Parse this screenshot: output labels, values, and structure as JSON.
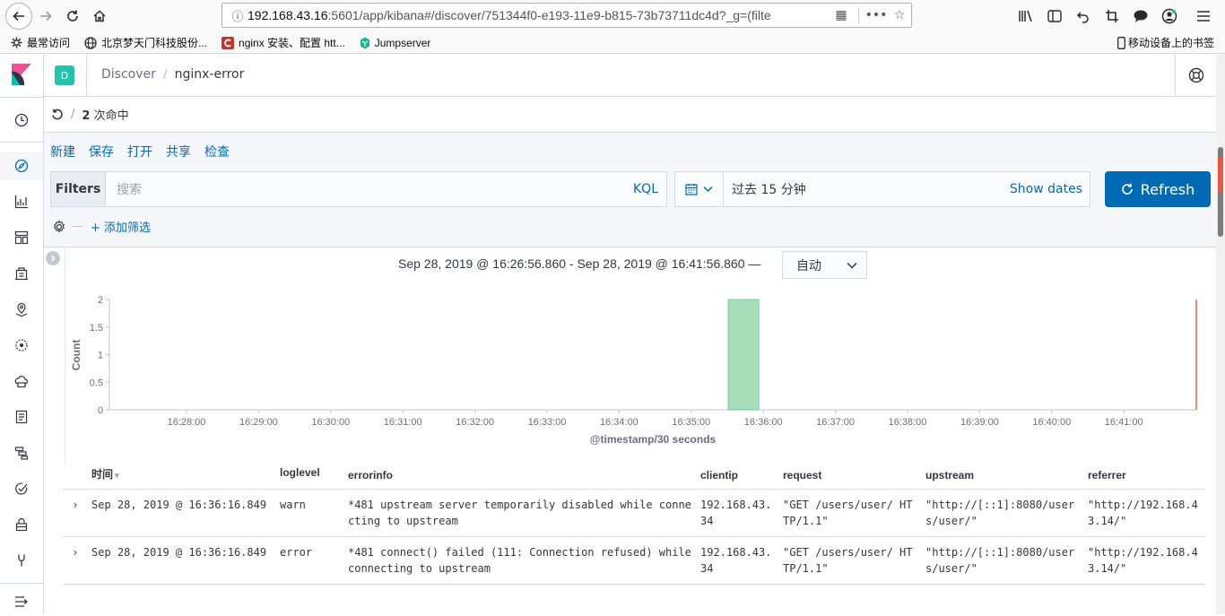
{
  "browser": {
    "url_host": "192.168.43.16",
    "url_rest": ":5601/app/kibana#/discover/751344f0-e193-11e9-b815-73b73711dc4d?_g=(filte",
    "bookmarks": [
      {
        "label": "最常访问"
      },
      {
        "label": "北京梦天门科技股份..."
      },
      {
        "label": "nginx 安装、配置 htt..."
      },
      {
        "label": "Jumpserver"
      }
    ],
    "mobile_bookmarks": "移动设备上的书签"
  },
  "kibana": {
    "space_initial": "D",
    "breadcrumbs": {
      "app": "Discover",
      "current": "nginx-error"
    },
    "hits_count": "2",
    "hits_label": "次命中",
    "menu": [
      "新建",
      "保存",
      "打开",
      "共享",
      "检查"
    ],
    "filters_label": "Filters",
    "search_placeholder": "搜索",
    "kql_label": "KQL",
    "date_range": "过去 15 分钟",
    "show_dates": "Show dates",
    "refresh_label": "Refresh",
    "add_filter": "+ 添加筛选",
    "time_range_text": "Sep 28, 2019 @ 16:26:56.860 - Sep 28, 2019 @ 16:41:56.860 —",
    "interval": "自动"
  },
  "chart_data": {
    "type": "bar",
    "xlabel": "@timestamp/30 seconds",
    "ylabel": "Count",
    "ylim": [
      0,
      2
    ],
    "y_ticks": [
      "0",
      "0.5",
      "1",
      "1.5",
      "2"
    ],
    "x_ticks": [
      "16:28:00",
      "16:29:00",
      "16:30:00",
      "16:31:00",
      "16:32:00",
      "16:33:00",
      "16:34:00",
      "16:35:00",
      "16:36:00",
      "16:37:00",
      "16:38:00",
      "16:39:00",
      "16:40:00",
      "16:41:00"
    ],
    "categories": [
      "16:36:00"
    ],
    "values": [
      2
    ],
    "bar_color": "#a8dfba",
    "bar_border": "#54b399",
    "now_marker_color": "#e7664c"
  },
  "table": {
    "columns": [
      "时间",
      "loglevel",
      "errorinfo",
      "clientip",
      "request",
      "upstream",
      "referrer"
    ],
    "rows": [
      {
        "time": "Sep 28, 2019 @ 16:36:16.849",
        "loglevel": "warn",
        "errorinfo": "*481 upstream server temporarily disabled while connecting to upstream",
        "clientip": "192.168.43.34",
        "request": "\"GET /users/user/ HTTP/1.1\"",
        "upstream": "\"http://[::1]:8080/users/user/\"",
        "referrer": "\"http://192.168.43.14/\""
      },
      {
        "time": "Sep 28, 2019 @ 16:36:16.849",
        "loglevel": "error",
        "errorinfo": "*481 connect() failed (111: Connection refused) while connecting to upstream",
        "clientip": "192.168.43.34",
        "request": "\"GET /users/user/ HTTP/1.1\"",
        "upstream": "\"http://[::1]:8080/users/user/\"",
        "referrer": "\"http://192.168.43.14/\""
      }
    ]
  }
}
